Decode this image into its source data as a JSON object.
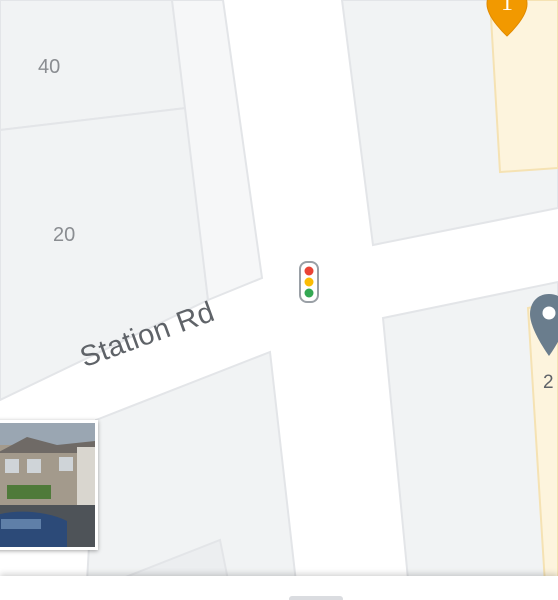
{
  "map": {
    "colors": {
      "road": "#ffffff",
      "block": "#f1f3f4",
      "block_edge": "#e3e5e8",
      "shop_area": "#fdf4dd",
      "shop_pin": "#f29900",
      "place_pin": "#6a7d8d"
    },
    "block_labels": [
      {
        "id": "40",
        "text": "40"
      },
      {
        "id": "20",
        "text": "20"
      }
    ],
    "street": {
      "name": "Station Rd"
    },
    "partial_number": "2",
    "pins": {
      "shop_pin_text": "1",
      "shop_pin_icon": "shopping-pin-icon",
      "place_pin_icon": "location-pin-icon"
    },
    "traffic_signal_icon": "traffic-light-icon",
    "street_view_thumbnail": {
      "alt": "Street View preview"
    }
  }
}
